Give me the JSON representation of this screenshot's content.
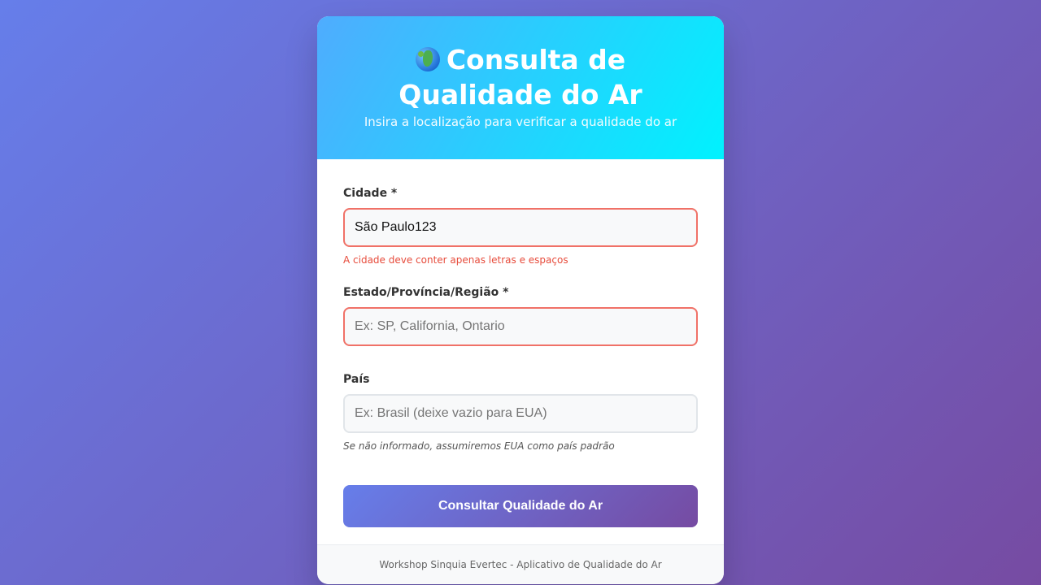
{
  "header": {
    "icon": "globe-africa-icon",
    "title": "Consulta de Qualidade do Ar",
    "subtitle": "Insira a localização para verificar a qualidade do ar"
  },
  "form": {
    "city": {
      "label": "Cidade *",
      "value": "São Paulo123",
      "placeholder": "",
      "error": "A cidade deve conter apenas letras e espaços"
    },
    "state": {
      "label": "Estado/Província/Região *",
      "value": "",
      "placeholder": "Ex: SP, California, Ontario"
    },
    "country": {
      "label": "País",
      "value": "",
      "placeholder": "Ex: Brasil (deixe vazio para EUA)",
      "hint": "Se não informado, assumiremos EUA como país padrão"
    },
    "submit_label": "Consultar Qualidade do Ar"
  },
  "footer": {
    "text": "Workshop Sinquia Evertec - Aplicativo de Qualidade do Ar"
  },
  "colors": {
    "background_start": "#667eea",
    "background_end": "#764ba2",
    "header_start": "#4facfe",
    "header_end": "#00f2fe",
    "error": "#e74c3c"
  }
}
